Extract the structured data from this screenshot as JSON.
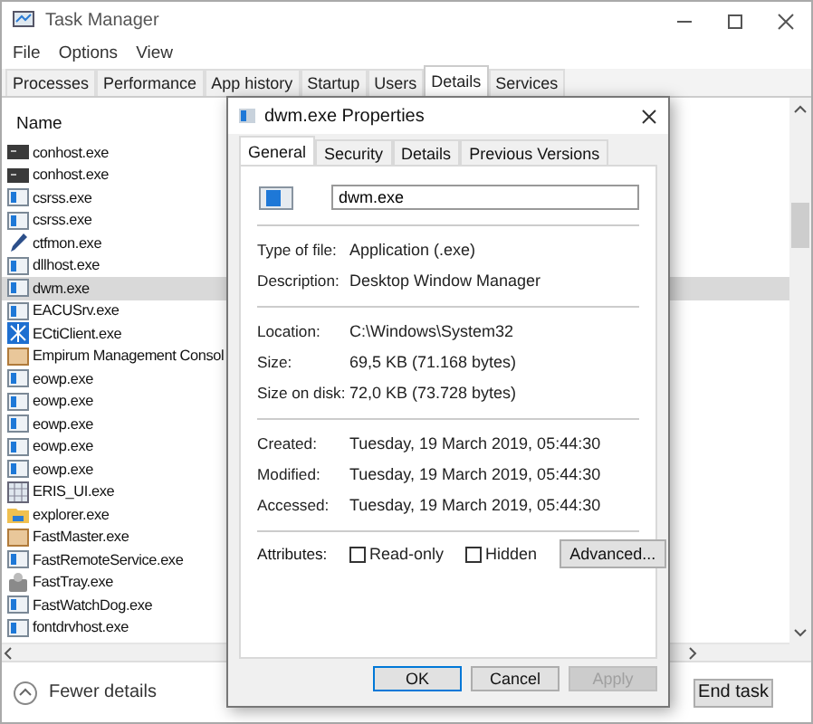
{
  "window": {
    "title": "Task Manager"
  },
  "menu": [
    "File",
    "Options",
    "View"
  ],
  "tabs": [
    {
      "label": "Processes",
      "selected": false
    },
    {
      "label": "Performance",
      "selected": false
    },
    {
      "label": "App history",
      "selected": false
    },
    {
      "label": "Startup",
      "selected": false
    },
    {
      "label": "Users",
      "selected": false
    },
    {
      "label": "Details",
      "selected": true
    },
    {
      "label": "Services",
      "selected": false
    }
  ],
  "process_list": {
    "columns": [
      "Name"
    ],
    "rows": [
      {
        "name": "conhost.exe",
        "kind": "console",
        "selected": false
      },
      {
        "name": "conhost.exe",
        "kind": "console",
        "selected": false
      },
      {
        "name": "csrss.exe",
        "kind": "window",
        "selected": false
      },
      {
        "name": "csrss.exe",
        "kind": "window",
        "selected": false
      },
      {
        "name": "ctfmon.exe",
        "kind": "pen",
        "selected": false
      },
      {
        "name": "dllhost.exe",
        "kind": "window",
        "selected": false
      },
      {
        "name": "dwm.exe",
        "kind": "window",
        "selected": true
      },
      {
        "name": "EACUSrv.exe",
        "kind": "window",
        "selected": false
      },
      {
        "name": "ECtiClient.exe",
        "kind": "network",
        "selected": false
      },
      {
        "name": "Empirum Management Consol",
        "kind": "box",
        "selected": false
      },
      {
        "name": "eowp.exe",
        "kind": "window",
        "selected": false
      },
      {
        "name": "eowp.exe",
        "kind": "window",
        "selected": false
      },
      {
        "name": "eowp.exe",
        "kind": "window",
        "selected": false
      },
      {
        "name": "eowp.exe",
        "kind": "window",
        "selected": false
      },
      {
        "name": "eowp.exe",
        "kind": "window",
        "selected": false
      },
      {
        "name": "ERIS_UI.exe",
        "kind": "grid",
        "selected": false
      },
      {
        "name": "explorer.exe",
        "kind": "folder",
        "selected": false
      },
      {
        "name": "FastMaster.exe",
        "kind": "box",
        "selected": false
      },
      {
        "name": "FastRemoteService.exe",
        "kind": "window",
        "selected": false
      },
      {
        "name": "FastTray.exe",
        "kind": "tray",
        "selected": false
      },
      {
        "name": "FastWatchDog.exe",
        "kind": "window",
        "selected": false
      },
      {
        "name": "fontdrvhost.exe",
        "kind": "window",
        "selected": false
      }
    ]
  },
  "footer": {
    "toggle": "Fewer details",
    "end_task": "End task"
  },
  "dialog": {
    "title": "dwm.exe Properties",
    "tabs": [
      {
        "label": "General",
        "selected": true
      },
      {
        "label": "Security",
        "selected": false
      },
      {
        "label": "Details",
        "selected": false
      },
      {
        "label": "Previous Versions",
        "selected": false
      }
    ],
    "file_name": "dwm.exe",
    "groups": [
      [
        {
          "label": "Type of file:",
          "value": "Application (.exe)"
        },
        {
          "label": "Description:",
          "value": "Desktop Window Manager"
        }
      ],
      [
        {
          "label": "Location:",
          "value": "C:\\Windows\\System32"
        },
        {
          "label": "Size:",
          "value": "69,5 KB (71.168 bytes)"
        },
        {
          "label": "Size on disk:",
          "value": "72,0 KB (73.728 bytes)"
        }
      ],
      [
        {
          "label": "Created:",
          "value": "Tuesday, 19 March 2019, 05:44:30"
        },
        {
          "label": "Modified:",
          "value": "Tuesday, 19 March 2019, 05:44:30"
        },
        {
          "label": "Accessed:",
          "value": "Tuesday, 19 March 2019, 05:44:30"
        }
      ]
    ],
    "attributes": {
      "label": "Attributes:",
      "options": [
        {
          "label": "Read-only",
          "checked": false
        },
        {
          "label": "Hidden",
          "checked": false
        }
      ],
      "advanced": "Advanced..."
    },
    "buttons": [
      {
        "label": "OK",
        "kind": "default",
        "disabled": false
      },
      {
        "label": "Cancel",
        "kind": "normal",
        "disabled": false
      },
      {
        "label": "Apply",
        "kind": "normal",
        "disabled": true
      }
    ]
  }
}
